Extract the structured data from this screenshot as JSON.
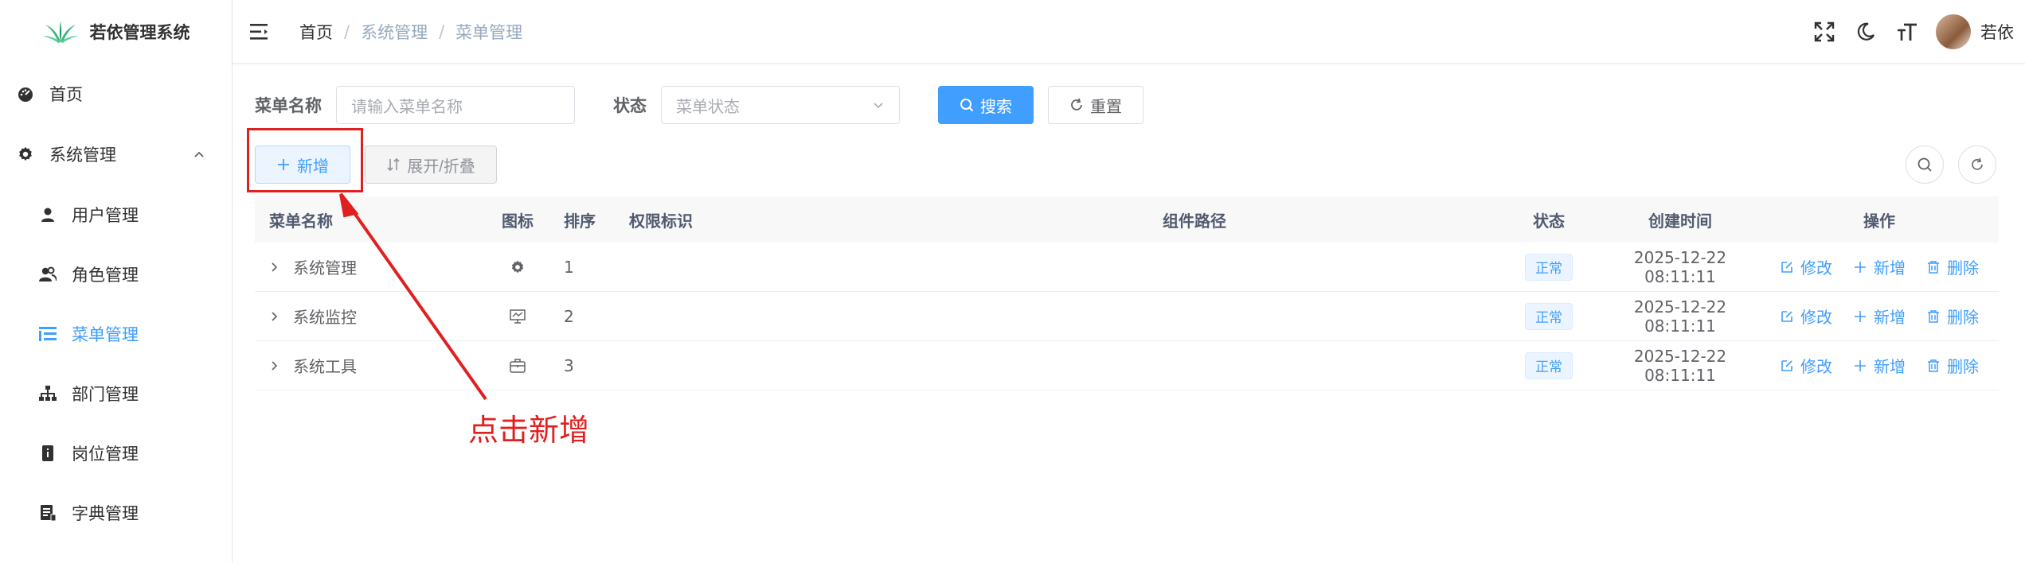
{
  "app": {
    "title": "若依管理系统"
  },
  "sidebar": {
    "home": "首页",
    "system": "系统管理",
    "items": [
      {
        "label": "用户管理",
        "icon": "user-icon"
      },
      {
        "label": "角色管理",
        "icon": "peoples-icon"
      },
      {
        "label": "菜单管理",
        "icon": "tree-table-icon",
        "active": true
      },
      {
        "label": "部门管理",
        "icon": "tree-icon"
      },
      {
        "label": "岗位管理",
        "icon": "post-icon"
      },
      {
        "label": "字典管理",
        "icon": "dict-icon"
      }
    ]
  },
  "breadcrumb": [
    "首页",
    "系统管理",
    "菜单管理"
  ],
  "user": {
    "name": "若依"
  },
  "search": {
    "name_label": "菜单名称",
    "name_placeholder": "请输入菜单名称",
    "status_label": "状态",
    "status_placeholder": "菜单状态",
    "search_btn": "搜索",
    "reset_btn": "重置"
  },
  "toolbar": {
    "add": "新增",
    "expand": "展开/折叠"
  },
  "annotation": {
    "text": "点击新增"
  },
  "table": {
    "headers": {
      "name": "菜单名称",
      "icon": "图标",
      "order": "排序",
      "perm": "权限标识",
      "path": "组件路径",
      "status": "状态",
      "time": "创建时间",
      "ops": "操作"
    },
    "rows": [
      {
        "name": "系统管理",
        "icon": "gear-icon",
        "order": "1",
        "perm": "",
        "path": "",
        "status": "正常",
        "time": "2025-12-22 08:11:11"
      },
      {
        "name": "系统监控",
        "icon": "monitor-icon",
        "order": "2",
        "perm": "",
        "path": "",
        "status": "正常",
        "time": "2025-12-22 08:11:11"
      },
      {
        "name": "系统工具",
        "icon": "toolbox-icon",
        "order": "3",
        "perm": "",
        "path": "",
        "status": "正常",
        "time": "2025-12-22 08:11:11"
      }
    ],
    "ops": {
      "edit": "修改",
      "add": "新增",
      "delete": "删除"
    }
  },
  "colors": {
    "primary": "#409eff",
    "annotation": "#e02020"
  }
}
